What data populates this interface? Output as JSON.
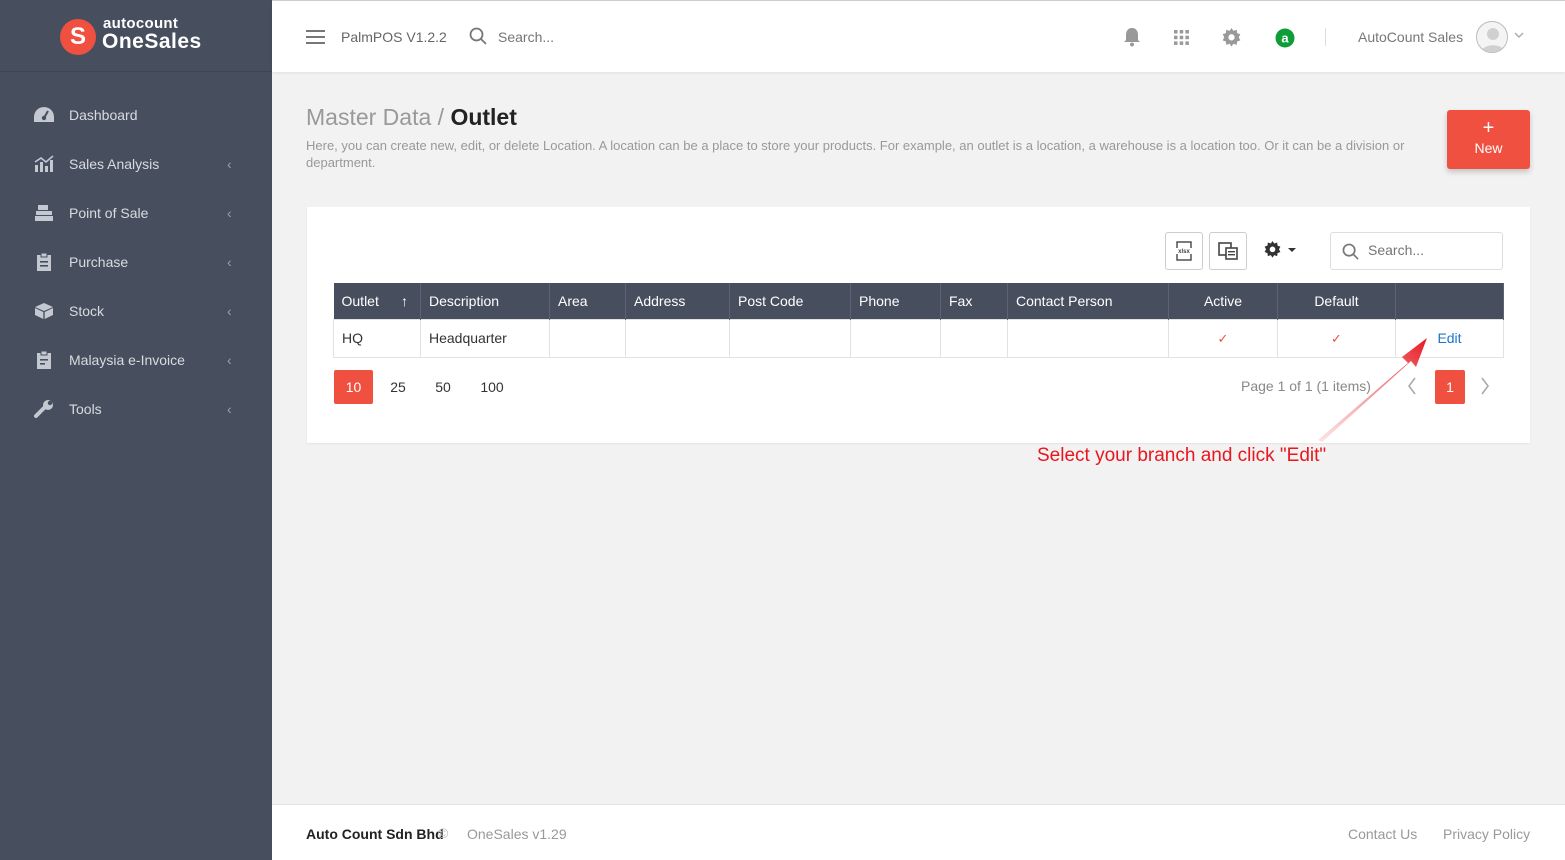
{
  "brand": {
    "logo_letter": "S",
    "top": "autocount",
    "bottom": "OneSales",
    "accent": "#f0503f",
    "sidebar_bg": "#474f5f"
  },
  "sidebar": {
    "items": [
      {
        "label": "Dashboard",
        "icon": "dashboard-icon",
        "has_chevron": false
      },
      {
        "label": "Sales Analysis",
        "icon": "chart-icon",
        "has_chevron": true
      },
      {
        "label": "Point of Sale",
        "icon": "cash-register-icon",
        "has_chevron": true
      },
      {
        "label": "Purchase",
        "icon": "clipboard-icon",
        "has_chevron": true
      },
      {
        "label": "Stock",
        "icon": "box-icon",
        "has_chevron": true
      },
      {
        "label": "Malaysia e-Invoice",
        "icon": "invoice-icon",
        "has_chevron": true
      },
      {
        "label": "Tools",
        "icon": "wrench-icon",
        "has_chevron": true
      }
    ],
    "chevron": "‹"
  },
  "header": {
    "app_version": "PalmPOS V1.2.2",
    "search_placeholder": "Search...",
    "user_name": "AutoCount Sales",
    "status_badge": "a"
  },
  "page": {
    "breadcrumb_parent": "Master Data / ",
    "breadcrumb_current": "Outlet",
    "description": "Here, you can create new, edit, or delete Location. A location can be a place to store your products. For example, an outlet is a location, a warehouse is a location too. Or it can be a division or department.",
    "new_button_plus": "+",
    "new_button_label": "New"
  },
  "toolbar": {
    "search_placeholder": "Search..."
  },
  "table": {
    "columns": [
      "Outlet",
      "Description",
      "Area",
      "Address",
      "Post Code",
      "Phone",
      "Fax",
      "Contact Person",
      "Active",
      "Default",
      ""
    ],
    "sort_indicator": "↑",
    "rows": [
      {
        "outlet": "HQ",
        "description": "Headquarter",
        "area": "",
        "address": "",
        "post_code": "",
        "phone": "",
        "fax": "",
        "contact_person": "",
        "active": "✓",
        "default": "✓",
        "action": "Edit"
      }
    ]
  },
  "pager": {
    "sizes": [
      "10",
      "25",
      "50",
      "100"
    ],
    "info": "Page 1 of 1 (1 items)",
    "current_page": "1",
    "prev": "‹",
    "next": "›"
  },
  "annotation": {
    "text": "Select your branch and click \"Edit\"",
    "color": "#e8161e"
  },
  "footer": {
    "company": "Auto Count Sdn Bhd",
    "copyright": "©",
    "version": "OneSales v1.29",
    "contact": "Contact Us",
    "privacy": "Privacy Policy"
  }
}
